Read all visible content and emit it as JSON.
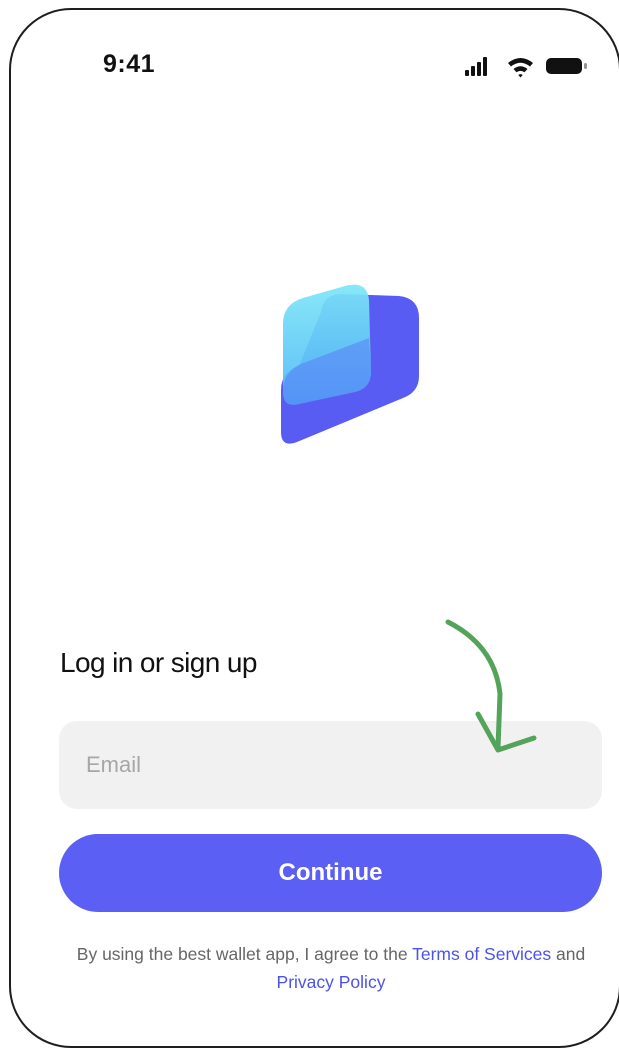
{
  "status_bar": {
    "time": "9:41",
    "icons": [
      "cellular-signal-icon",
      "wifi-icon",
      "battery-icon"
    ]
  },
  "logo": {
    "icon": "wallet-logo-icon",
    "colors": {
      "back_card": "#585cf2",
      "front_card_top": "#7de6f7",
      "front_card_bottom": "#4fb6f6"
    }
  },
  "login": {
    "heading": "Log in or sign up",
    "email_placeholder": "Email",
    "email_value": "",
    "continue_label": "Continue"
  },
  "legal": {
    "prefix": "By using the best wallet app, I agree to the ",
    "terms_label": "Terms of Services",
    "connector": " and ",
    "privacy_label": "Privacy Policy"
  },
  "annotation": {
    "icon": "curved-arrow-icon",
    "color": "#53a35a"
  },
  "colors": {
    "accent": "#5b5ff3",
    "link": "#4b53ea",
    "field_background": "#f1f1f1"
  }
}
